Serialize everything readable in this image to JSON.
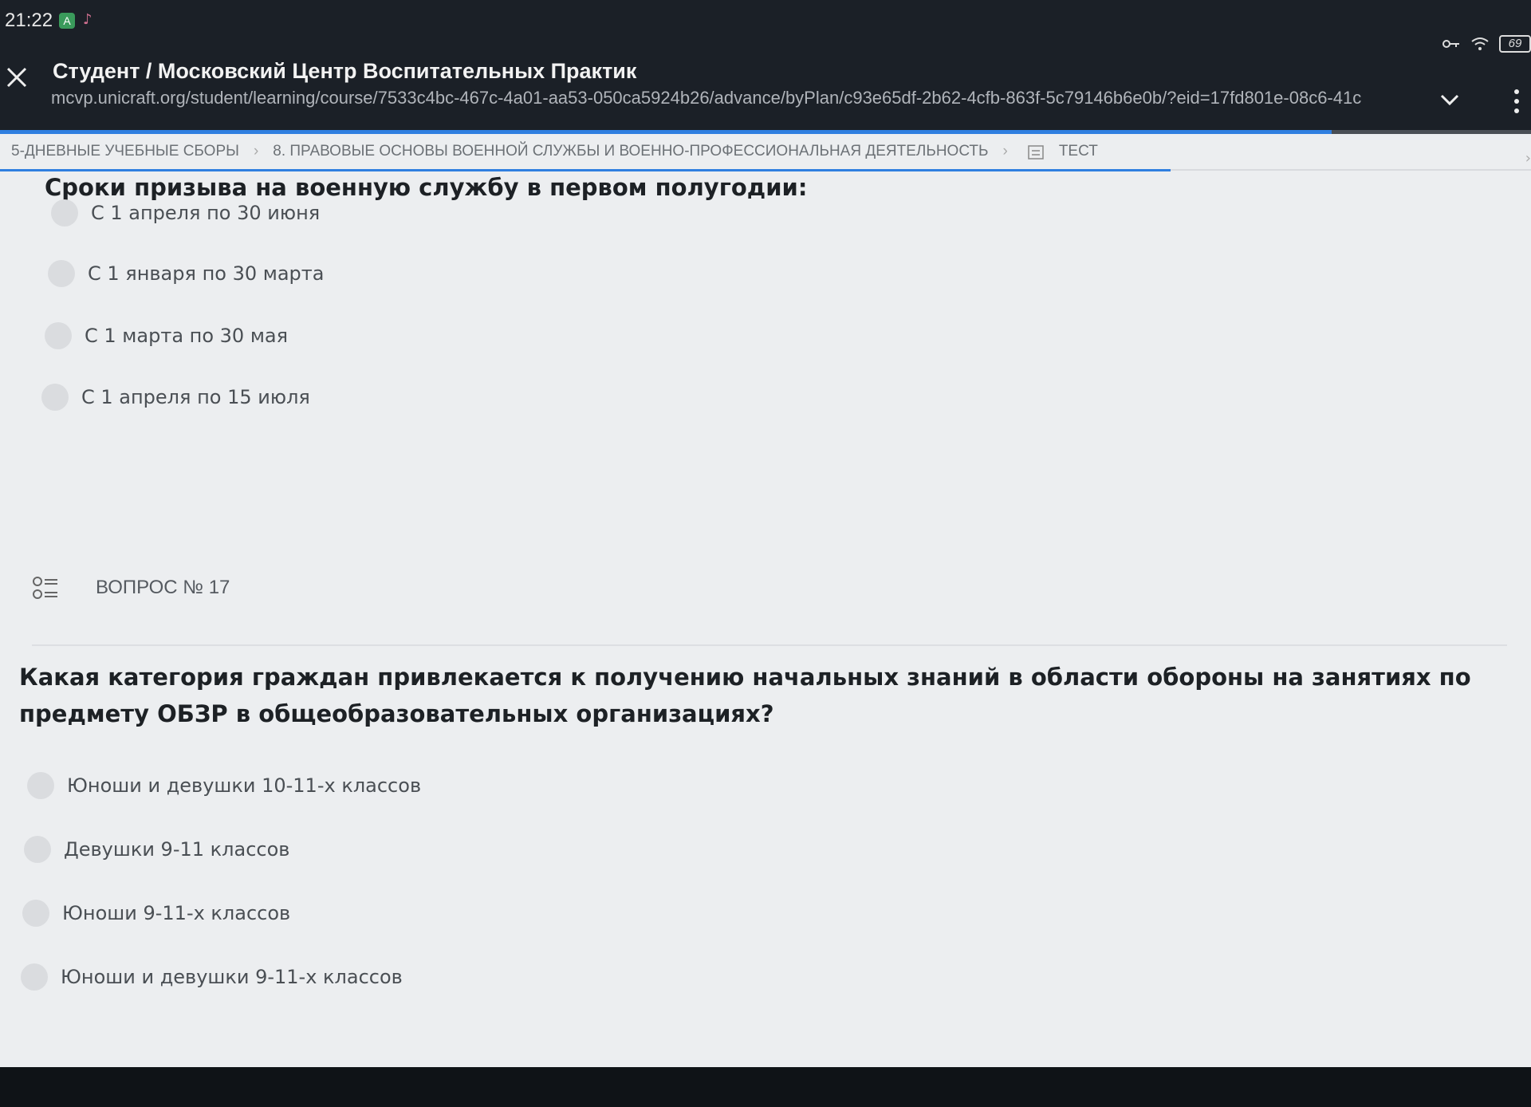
{
  "status": {
    "time": "21:22",
    "badge": "A",
    "battery": "69"
  },
  "toolbar": {
    "title": "Студент / Московский Центр Воспитательных Практик",
    "url": "mcvp.unicraft.org/student/learning/course/7533c4bc-467c-4a01-aa53-050ca5924b26/advance/byPlan/c93e65df-2b62-4cfb-863f-5c79146b6e0b/?eid=17fd801e-08c6-41c",
    "page_load_progress": 0.87
  },
  "breadcrumb": {
    "items": [
      "5-ДНЕВНЫЕ УЧЕБНЫЕ СБОРЫ",
      "8. ПРАВОВЫЕ ОСНОВЫ ВОЕННОЙ СЛУЖБЫ И ВОЕННО-ПРОФЕССИОНАЛЬНАЯ ДЕЯТЕЛЬНОСТЬ",
      "ТЕСТ"
    ]
  },
  "question_prev": {
    "text": "Сроки призыва на военную службу в первом полугодии:",
    "options": [
      "С 1 апреля по 30 июня",
      "С 1 января по 30 марта",
      "С 1 марта по 30 мая",
      "С 1 апреля по 15 июля"
    ]
  },
  "question_current": {
    "header": "ВОПРОС № 17",
    "text": "Какая категория граждан привлекается к получению начальных знаний в области обороны на занятиях по предмету ОБЗР в общеобразовательных организациях?",
    "options": [
      "Юноши и девушки 10-11-х классов",
      "Девушки 9-11 классов",
      "Юноши 9-11-х классов",
      "Юноши и девушки 9-11-х классов"
    ]
  },
  "colors": {
    "accent": "#2f7fe0",
    "page_bg": "#eceef0",
    "toolbar_bg": "#1b2027"
  }
}
